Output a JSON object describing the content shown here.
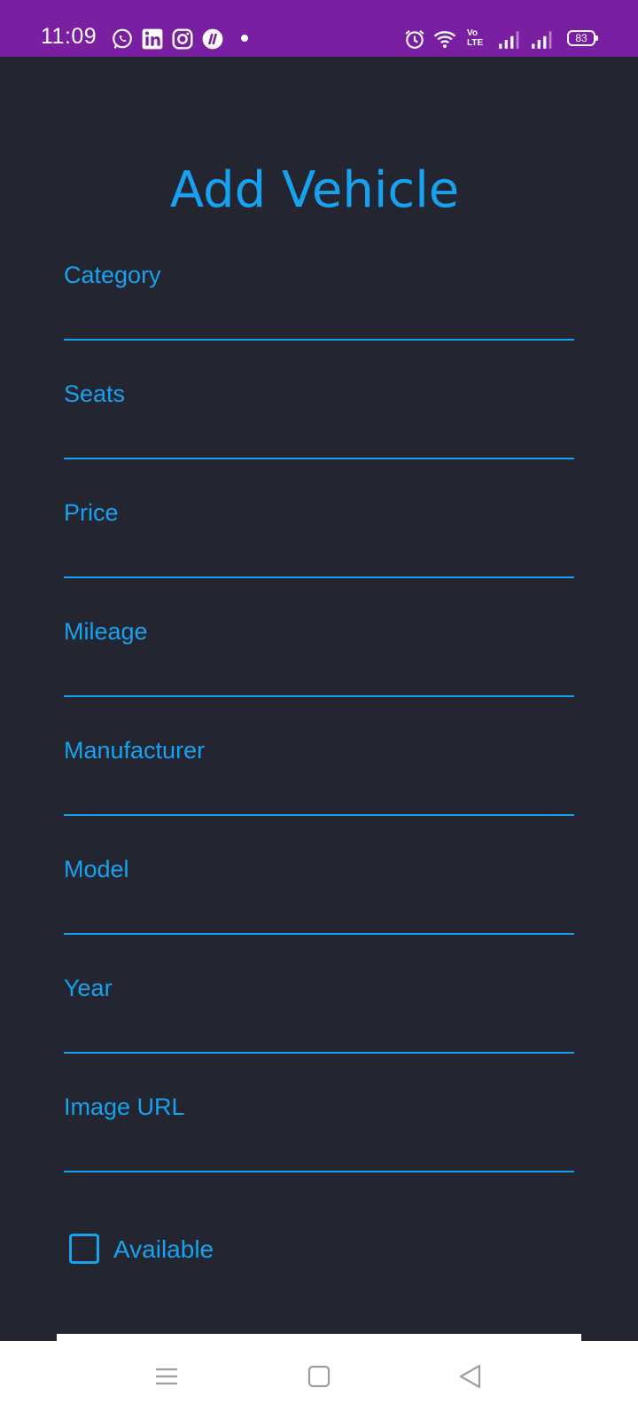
{
  "status_bar": {
    "time": "11:09",
    "notification_icons": [
      "whatsapp-icon",
      "linkedin-icon",
      "instagram-icon",
      "app-icon"
    ],
    "system_icons": [
      "alarm-icon",
      "wifi-icon",
      "volte-icon",
      "signal-icon",
      "signal-icon",
      "battery-icon"
    ],
    "volte_line1": "Vo",
    "volte_line2": "LTE",
    "battery_level": "83",
    "background_color": "#7b1fa2"
  },
  "page": {
    "title": "Add Vehicle",
    "background_color": "#232531",
    "accent_color": "#16a2f0"
  },
  "form": {
    "fields": [
      {
        "label": "Category",
        "value": ""
      },
      {
        "label": "Seats",
        "value": ""
      },
      {
        "label": "Price",
        "value": ""
      },
      {
        "label": "Mileage",
        "value": ""
      },
      {
        "label": "Manufacturer",
        "value": ""
      },
      {
        "label": "Model",
        "value": ""
      },
      {
        "label": "Year",
        "value": ""
      },
      {
        "label": "Image URL",
        "value": ""
      }
    ],
    "available": {
      "label": "Available",
      "checked": false
    }
  },
  "nav_bar": {
    "buttons": [
      "menu-icon",
      "home-icon",
      "back-icon"
    ]
  }
}
